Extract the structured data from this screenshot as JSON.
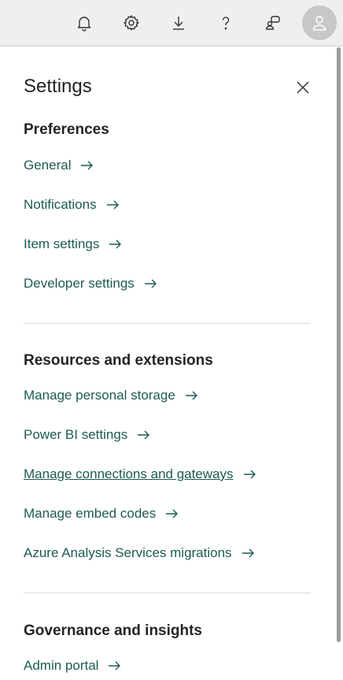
{
  "topbar": {
    "icons": [
      "bell-icon",
      "gear-icon",
      "download-icon",
      "help-icon",
      "feedback-icon",
      "avatar-icon"
    ]
  },
  "panel": {
    "title": "Settings"
  },
  "sections": [
    {
      "heading": "Preferences",
      "items": [
        "General",
        "Notifications",
        "Item settings",
        "Developer settings"
      ]
    },
    {
      "heading": "Resources and extensions",
      "items": [
        "Manage personal storage",
        "Power BI settings",
        "Manage connections and gateways",
        "Manage embed codes",
        "Azure Analysis Services migrations"
      ]
    },
    {
      "heading": "Governance and insights",
      "items": [
        "Admin portal"
      ]
    }
  ],
  "colors": {
    "link": "#1d5a54",
    "heading": "#242424",
    "topbar": "#efefef",
    "avatar": "#c7c7c7"
  }
}
